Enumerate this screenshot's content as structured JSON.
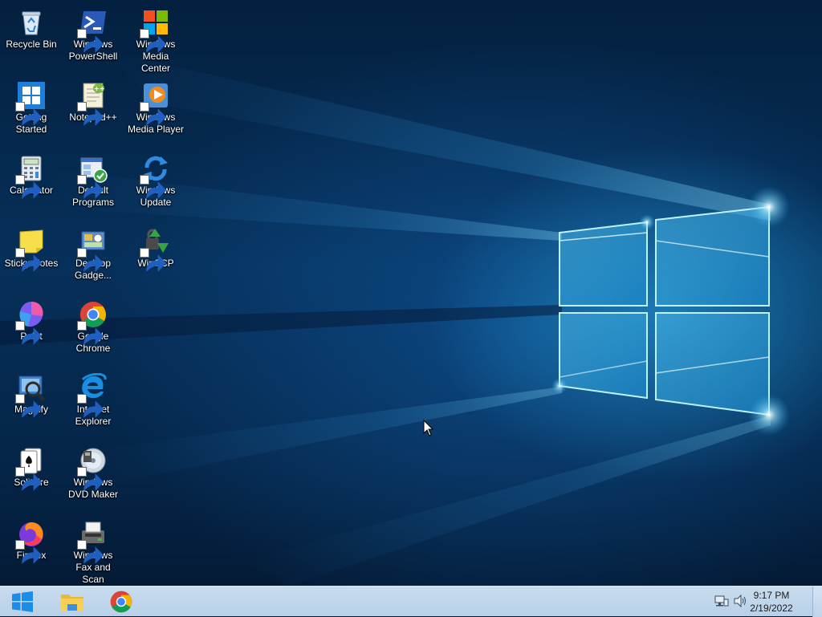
{
  "desktop": {
    "icons": [
      {
        "label": "Recycle Bin",
        "icon": "recycle-bin-icon",
        "shortcut": false
      },
      {
        "label": "Windows PowerShell",
        "icon": "powershell-icon",
        "shortcut": true
      },
      {
        "label": "Windows Media Center",
        "icon": "media-center-icon",
        "shortcut": true
      },
      {
        "label": "Getting Started",
        "icon": "getting-started-icon",
        "shortcut": true
      },
      {
        "label": "Notepad++",
        "icon": "notepad-plus-plus-icon",
        "shortcut": true
      },
      {
        "label": "Windows Media Player",
        "icon": "media-player-icon",
        "shortcut": true
      },
      {
        "label": "Calculator",
        "icon": "calculator-icon",
        "shortcut": true
      },
      {
        "label": "Default Programs",
        "icon": "default-programs-icon",
        "shortcut": true
      },
      {
        "label": "Windows Update",
        "icon": "windows-update-icon",
        "shortcut": true
      },
      {
        "label": "Sticky Notes",
        "icon": "sticky-notes-icon",
        "shortcut": true
      },
      {
        "label": "Desktop Gadge...",
        "icon": "desktop-gadgets-icon",
        "shortcut": true
      },
      {
        "label": "WinSCP",
        "icon": "winscp-icon",
        "shortcut": true
      },
      {
        "label": "Paint",
        "icon": "paint-icon",
        "shortcut": true
      },
      {
        "label": "Google Chrome",
        "icon": "chrome-icon",
        "shortcut": true
      },
      {
        "label": "Magnify",
        "icon": "magnify-icon",
        "shortcut": true
      },
      {
        "label": "Internet Explorer",
        "icon": "internet-explorer-icon",
        "shortcut": true
      },
      {
        "label": "Solitaire",
        "icon": "solitaire-icon",
        "shortcut": true
      },
      {
        "label": "Windows DVD Maker",
        "icon": "dvd-maker-icon",
        "shortcut": true
      },
      {
        "label": "Firefox",
        "icon": "firefox-icon",
        "shortcut": true
      },
      {
        "label": "Windows Fax and Scan",
        "icon": "fax-scan-icon",
        "shortcut": true
      }
    ]
  },
  "taskbar": {
    "start_icon": "windows-logo-icon",
    "pinned": [
      {
        "name": "File Explorer",
        "icon": "file-explorer-icon"
      },
      {
        "name": "Google Chrome",
        "icon": "chrome-icon"
      }
    ],
    "tray": {
      "network_icon": "network-icon",
      "volume_icon": "volume-icon",
      "time": "9:17 PM",
      "date": "2/19/2022"
    }
  },
  "colors": {
    "taskbar": "#c0d5ec",
    "wallpaper_dark": "#04203f",
    "wallpaper_glow": "#28aae6"
  }
}
